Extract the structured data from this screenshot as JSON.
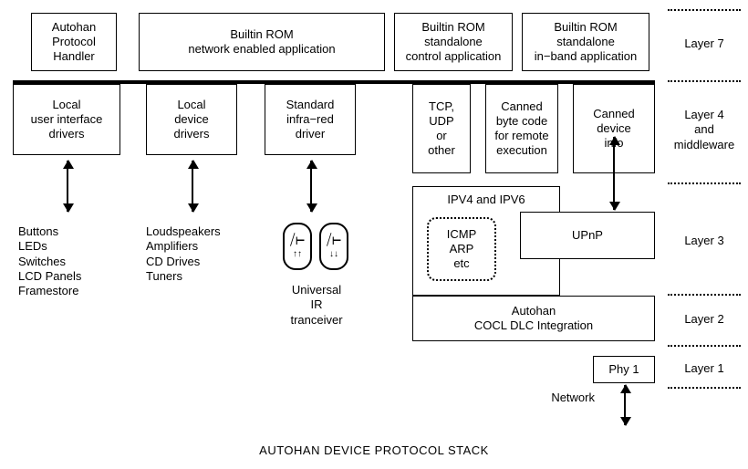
{
  "title": "AUTOHAN DEVICE PROTOCOL STACK",
  "row1": {
    "autohan": "Autohan\nProtocol\nHandler",
    "network_app": "Builtin ROM\nnetwork enabled application",
    "control_app": "Builtin ROM\nstandalone\ncontrol application",
    "inband_app": "Builtin ROM\nstandalone\nin−band application"
  },
  "row2": {
    "ui_drivers": "Local\nuser interface\ndrivers",
    "device_drivers": "Local\ndevice\ndrivers",
    "ir_driver": "Standard\ninfra−red\ndriver",
    "tcp": "TCP,\nUDP\nor\nother",
    "bytecode": "Canned\nbyte code\nfor remote\nexecution",
    "devinfo": "Canned\ndevice\ninfo"
  },
  "lists": {
    "ui": "Buttons\nLEDs\nSwitches\nLCD Panels\nFramestore",
    "dev": "Loudspeakers\nAmplifiers\nCD Drives\nTuners",
    "ir": "Universal\nIR\ntranceiver"
  },
  "net": {
    "ipv": "IPV4 and IPV6",
    "icmp": "ICMP\nARP\netc",
    "upnp": "UPnP",
    "cocl": "Autohan\nCOCL DLC Integration",
    "phy": "Phy 1",
    "network": "Network"
  },
  "layers": {
    "l7": "Layer 7",
    "l4": "Layer 4\nand\nmiddleware",
    "l3": "Layer 3",
    "l2": "Layer 2",
    "l1": "Layer 1"
  }
}
